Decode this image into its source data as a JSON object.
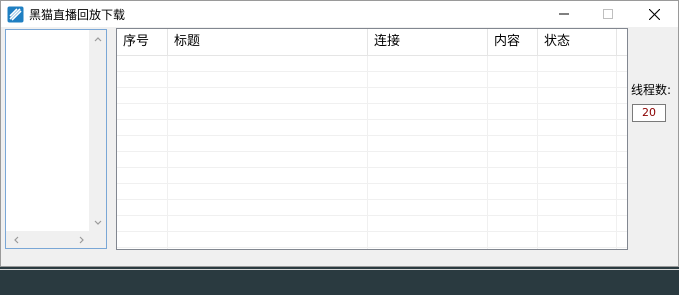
{
  "window": {
    "title": "黑猫直播回放下载",
    "controls": {
      "minimize": "minimize-icon",
      "maximize": "maximize-icon",
      "close": "close-icon"
    }
  },
  "table": {
    "columns": [
      "序号",
      "标题",
      "连接",
      "内容",
      "状态"
    ],
    "rows": []
  },
  "threads": {
    "label": "线程数:",
    "value": "20"
  }
}
